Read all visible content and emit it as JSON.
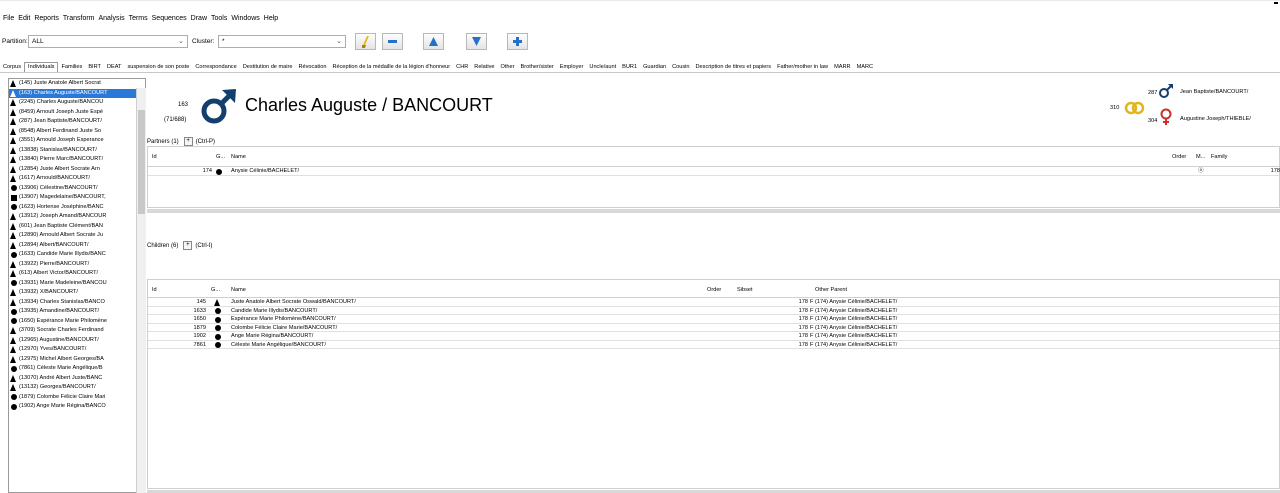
{
  "menu": [
    "File",
    "Edit",
    "Reports",
    "Transform",
    "Analysis",
    "Terms",
    "Sequences",
    "Draw",
    "Tools",
    "Windows",
    "Help"
  ],
  "toolbar": {
    "partition_label": "Partition:",
    "partition_value": "ALL",
    "cluster_label": "Cluster:",
    "cluster_value": "*"
  },
  "tabs": [
    "Corpus",
    "Individuals",
    "Families",
    "BIRT",
    "DEAT",
    "suspension de son poste",
    "Correspondance",
    "Destitution de maire",
    "Révocation",
    "Réception de la médaille de la légion d'honneur",
    "CHR",
    "Relative",
    "Other",
    "Brother/sister",
    "Employer",
    "Uncle/aunt",
    "BUR1",
    "Guardian",
    "Cousin",
    "Description de titres et papiers",
    "Father/mother in law",
    "MARR",
    "MARC"
  ],
  "active_tab": "Individuals",
  "individuals": [
    {
      "g": "m",
      "t": "(145) Juste Anatole Albert Socrat"
    },
    {
      "g": "m",
      "t": "(163) Charles Auguste/BANCOURT",
      "sel": true
    },
    {
      "g": "m",
      "t": "(2245) Charles Auguste/BANCOU"
    },
    {
      "g": "m",
      "t": "(8459) Arnoult Joseph Juste Espé"
    },
    {
      "g": "m",
      "t": "(287) Jean Baptiste/BANCOURT/"
    },
    {
      "g": "m",
      "t": "(8548) Albert Ferdinand Juste So"
    },
    {
      "g": "m",
      "t": "(3551) Arnould Joseph Esperance"
    },
    {
      "g": "m",
      "t": "(13838) Stanislas/BANCOURT/"
    },
    {
      "g": "m",
      "t": "(13840) Pierre Marc/BANCOURT/"
    },
    {
      "g": "m",
      "t": "(12854) Juste Albert Socrate Arn"
    },
    {
      "g": "m",
      "t": "(1617) Arnould/BANCOURT/"
    },
    {
      "g": "f",
      "t": "(13906) Célestine/BANCOURT/"
    },
    {
      "g": "u",
      "t": "(13907) Magedelaine/BANCOURT,"
    },
    {
      "g": "f",
      "t": "(1623) Hortense Joséphine/BANC"
    },
    {
      "g": "m",
      "t": "(13912) Joseph Amand/BANCOUR"
    },
    {
      "g": "m",
      "t": "(601) Jean Baptiste Clément/BAN"
    },
    {
      "g": "m",
      "t": "(12890) Arnould Albert Socrate Ju"
    },
    {
      "g": "m",
      "t": "(12894) Albert/BANCOURT/"
    },
    {
      "g": "f",
      "t": "(1633) Candide Marie Illydis/BANC"
    },
    {
      "g": "m",
      "t": "(13922) Pierre/BANCOURT/"
    },
    {
      "g": "m",
      "t": "(613) Albert Victor/BANCOURT/"
    },
    {
      "g": "f",
      "t": "(13931) Marie Madeleine/BANCOU"
    },
    {
      "g": "m",
      "t": "(13932) X/BANCOURT/"
    },
    {
      "g": "m",
      "t": "(13934) Charles Stanislas/BANCO"
    },
    {
      "g": "f",
      "t": "(13935) Amandine/BANCOURT/"
    },
    {
      "g": "f",
      "t": "(1650) Espérance Marie Philomène"
    },
    {
      "g": "m",
      "t": "(3709) Socrate Charles Ferdinand"
    },
    {
      "g": "m",
      "t": "(12965) Augustine/BANCOURT/"
    },
    {
      "g": "m",
      "t": "(12970) Yves/BANCOURT/"
    },
    {
      "g": "m",
      "t": "(12975) Michel Albert Georges/BA"
    },
    {
      "g": "f",
      "t": "(7861) Céleste Marie Angélique/B"
    },
    {
      "g": "m",
      "t": "(13070) André Albert Juste/BANC"
    },
    {
      "g": "m",
      "t": "(13132) Georges/BANCOURT/"
    },
    {
      "g": "f",
      "t": "(1879) Colombe Félicie Claire Mari"
    },
    {
      "g": "f",
      "t": "(1902) Ange Marie Régina/BANCO"
    }
  ],
  "person": {
    "id": "163",
    "sub": "(71/688)",
    "name": "Charles Auguste / BANCOURT",
    "marriage_id": "310",
    "father_id": "287",
    "father_name": "Jean Baptiste/BANCOURT/",
    "mother_id": "304",
    "mother_name": "Augustine Joseph/THIEBLE/"
  },
  "partners": {
    "title": "Partners (1)",
    "shortcut": "(Ctrl-P)",
    "headers": {
      "id": "Id",
      "g": "G...",
      "name": "Name",
      "order": "Order",
      "m": "M...",
      "family": "Family"
    },
    "rows": [
      {
        "id": "174",
        "g": "f",
        "name": "Anysie Célinie/BACHELET/",
        "family": "178"
      }
    ]
  },
  "children": {
    "title": "Children (6)",
    "shortcut": "(Ctrl-I)",
    "headers": {
      "id": "Id",
      "g": "G...",
      "name": "Name",
      "order": "Order",
      "sibset": "Sibset",
      "other": "Other Parent"
    },
    "rows": [
      {
        "id": "145",
        "g": "m",
        "name": "Juste Anatole Albert Socrate Oswald/BANCOURT/",
        "sibset": "178",
        "other": "F (174) Anysie Célinie/BACHELET/"
      },
      {
        "id": "1633",
        "g": "f",
        "name": "Candide Marie Illydis/BANCOURT/",
        "sibset": "178",
        "other": "F (174) Anysie Célinie/BACHELET/"
      },
      {
        "id": "1650",
        "g": "f",
        "name": "Espérance Marie Philomène/BANCOURT/",
        "sibset": "178",
        "other": "F (174) Anysie Célinie/BACHELET/"
      },
      {
        "id": "1879",
        "g": "f",
        "name": "Colombe Félicie Claire Marie/BANCOURT/",
        "sibset": "178",
        "other": "F (174) Anysie Célinie/BACHELET/"
      },
      {
        "id": "1902",
        "g": "f",
        "name": "Ange Marie Régina/BANCOURT/",
        "sibset": "178",
        "other": "F (174) Anysie Célinie/BACHELET/"
      },
      {
        "id": "7861",
        "g": "f",
        "name": "Céleste Marie Angélique/BANCOURT/",
        "sibset": "178",
        "other": "F (174) Anysie Célinie/BACHELET/"
      }
    ]
  },
  "colors": {
    "male": "#123f6e",
    "female": "#c8322b",
    "marriage_rings": "#e0b51a",
    "selection": "#2a79d8",
    "button_yellow": "#e6b820",
    "button_blue": "#2372c8"
  }
}
